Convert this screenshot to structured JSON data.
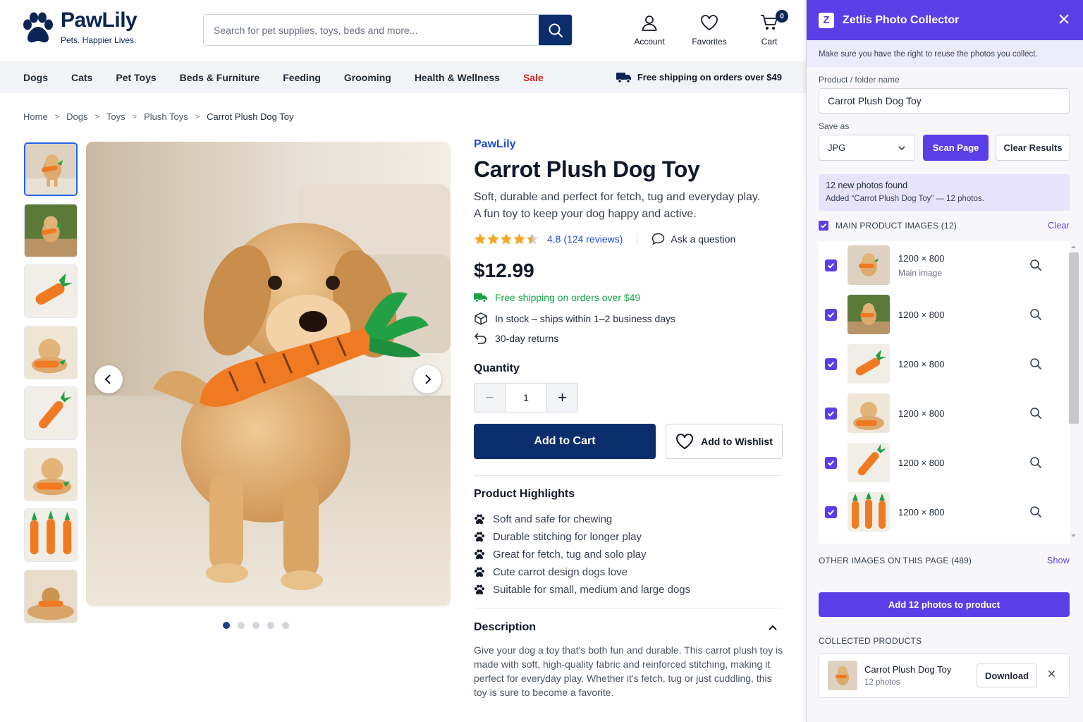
{
  "header": {
    "brand_name": "PawLily",
    "brand_tagline": "Pets. Happier Lives.",
    "search_placeholder": "Search for pet supplies, toys, beds and more...",
    "account_label": "Account",
    "favorites_label": "Favorites",
    "cart_label": "Cart",
    "cart_count": "0",
    "brand_color": "#0b2454",
    "icons": [
      "paw-logo-icon",
      "search-icon",
      "user-icon",
      "heart-icon",
      "cart-icon"
    ]
  },
  "nav": {
    "items": [
      "Dogs",
      "Cats",
      "Pet Toys",
      "Beds & Furniture",
      "Feeding",
      "Grooming",
      "Health & Wellness",
      "Sale"
    ],
    "sale_color": "#dc2626",
    "shipping_note": "Free shipping on orders over $49",
    "shipping_icon": "truck-icon"
  },
  "breadcrumb": [
    "Home",
    "Dogs",
    "Toys",
    "Plush Toys",
    "Carrot Plush Dog Toy"
  ],
  "gallery": {
    "thumbnail_count": 8,
    "active_thumbnail": 1,
    "dot_count": 5,
    "active_dot": 1
  },
  "product": {
    "brand": "PawLily",
    "title": "Carrot Plush Dog Toy",
    "subtitle_line1": "Soft, durable and perfect for fetch, tug and everyday play.",
    "subtitle_line2": "A fun toy to keep your dog happy and active.",
    "rating": 4.5,
    "rating_text": "4.8 (124 reviews)",
    "ask_question": "Ask a question",
    "price": "$12.99",
    "free_shipping": "Free shipping on orders over $49",
    "free_shipping_color": "#16a34a",
    "stock": "In stock – ships within 1–2 business days",
    "returns": "30-day returns",
    "quantity_label": "Quantity",
    "quantity_value": "1",
    "add_to_cart": "Add to Cart",
    "add_to_wishlist": "Add to Wishlist",
    "highlights_title": "Product Highlights",
    "highlights": [
      "Soft and safe for chewing",
      "Durable stitching for longer play",
      "Great for fetch, tug and solo play",
      "Cute carrot design dogs love",
      "Suitable for small, medium and large dogs"
    ],
    "description_title": "Description",
    "description": "Give your dog a toy that's both fun and durable. This carrot plush toy is made with soft, high-quality fabric and reinforced stitching, making it perfect for everyday play. Whether it's fetch, tug or just cuddling, this toy is sure to become a favorite."
  },
  "extension": {
    "logo_letter": "Z",
    "title": "Zetlis Photo Collector",
    "accent_color": "#5a3ee6",
    "notice": "Make sure you have the right to reuse the photos you collect.",
    "folder_label": "Product / folder name",
    "folder_value": "Carrot Plush Dog Toy",
    "save_as_label": "Save as",
    "save_as_value": "JPG",
    "scan_button": "Scan Page",
    "clear_results_button": "Clear Results",
    "found_title": "12 new photos found",
    "found_detail": "Added “Carrot Plush Dog Toy” — 12 photos.",
    "main_section_label": "MAIN PRODUCT IMAGES (12)",
    "main_section_action": "Clear",
    "images": [
      {
        "size": "1200 × 800",
        "note": "Main image",
        "checked": true
      },
      {
        "size": "1200 × 800",
        "note": "",
        "checked": true
      },
      {
        "size": "1200 × 800",
        "note": "",
        "checked": true
      },
      {
        "size": "1200 × 800",
        "note": "",
        "checked": true
      },
      {
        "size": "1200 × 800",
        "note": "",
        "checked": true
      },
      {
        "size": "1200 × 800",
        "note": "",
        "checked": true
      }
    ],
    "other_section_label": "OTHER IMAGES ON THIS PAGE (489)",
    "other_section_action": "Show",
    "add_button": "Add 12 photos to product",
    "collected_label": "COLLECTED PRODUCTS",
    "collected": [
      {
        "name": "Carrot Plush Dog Toy",
        "count": "12 photos",
        "download": "Download"
      }
    ]
  }
}
